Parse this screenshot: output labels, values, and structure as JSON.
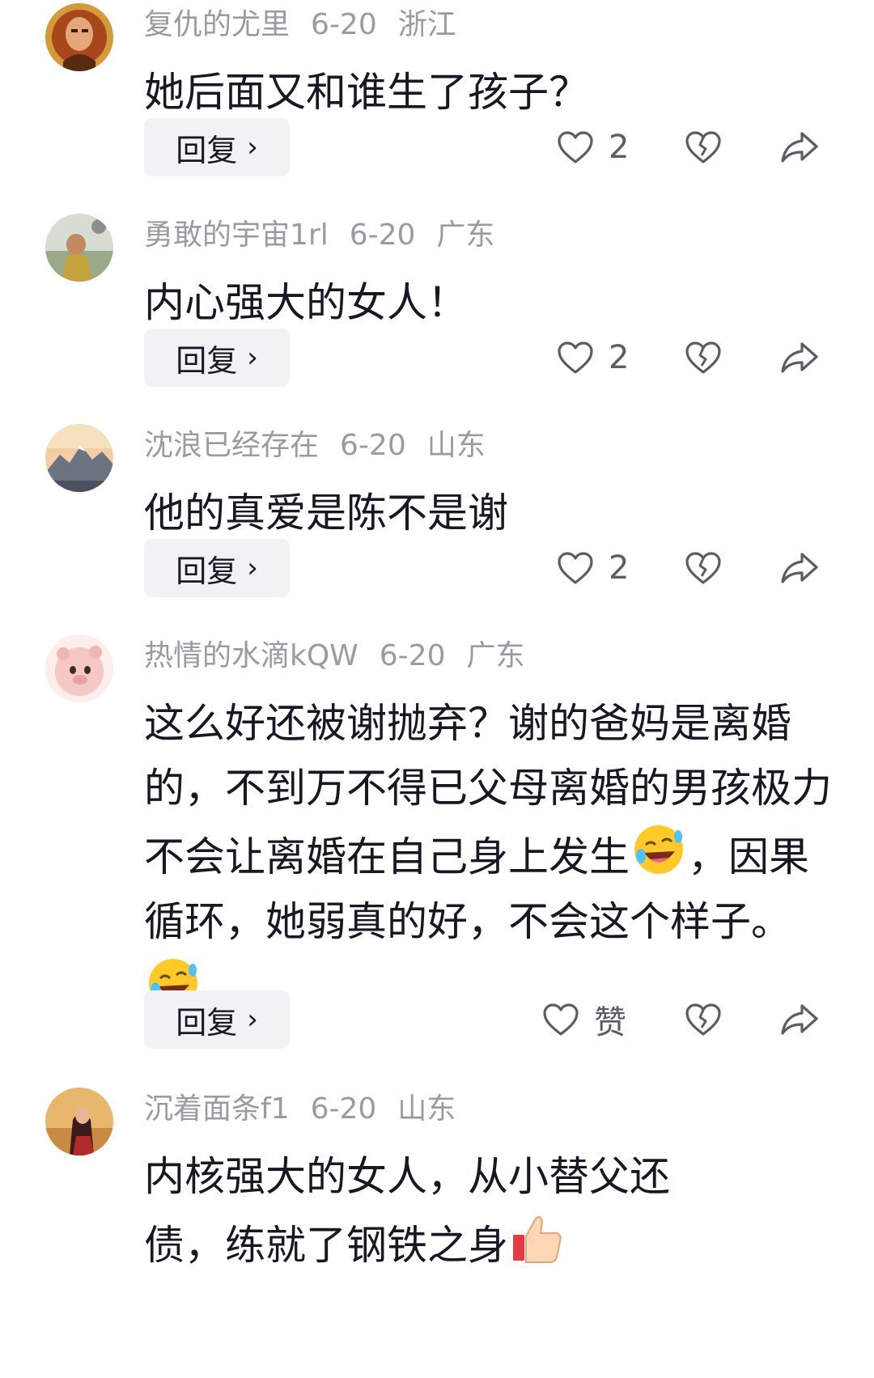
{
  "comments": [
    {
      "username": "复仇的尤里",
      "date": "6-20",
      "location": "浙江",
      "text": "她后面又和谁生了孩子？",
      "reply_label": "回复",
      "likes": "2",
      "avatar_colors": [
        "#b8632a",
        "#5a2a10"
      ]
    },
    {
      "username": "勇敢的宇宙1rl",
      "date": "6-20",
      "location": "广东",
      "text": "内心强大的女人！",
      "reply_label": "回复",
      "likes": "2",
      "avatar_colors": [
        "#a9b7a0",
        "#b8a14a"
      ]
    },
    {
      "username": "沈浪已经存在",
      "date": "6-20",
      "location": "山东",
      "text": "他的真爱是陈不是谢",
      "reply_label": "回复",
      "likes": "2",
      "avatar_colors": [
        "#f0c79a",
        "#5d6b78"
      ]
    },
    {
      "username": "热情的水滴kQW",
      "date": "6-20",
      "location": "广东",
      "text_part1": "这么好还被谢抛弃？谢的爸妈是离婚的，不到万不得已父母离婚的男孩极力不会让离婚在自己身上发生",
      "text_part2": "，因果循环，她弱真的好，不会这个样子。",
      "reply_label": "回复",
      "likes": "赞",
      "avatar_colors": [
        "#f7d9d6",
        "#e9a3a0"
      ]
    },
    {
      "username": "沉着面条f1",
      "date": "6-20",
      "location": "山东",
      "text": "内核强大的女人，从小替父还债，练就了钢铁之身",
      "avatar_colors": [
        "#e9b76b",
        "#7a2a2a"
      ]
    }
  ]
}
